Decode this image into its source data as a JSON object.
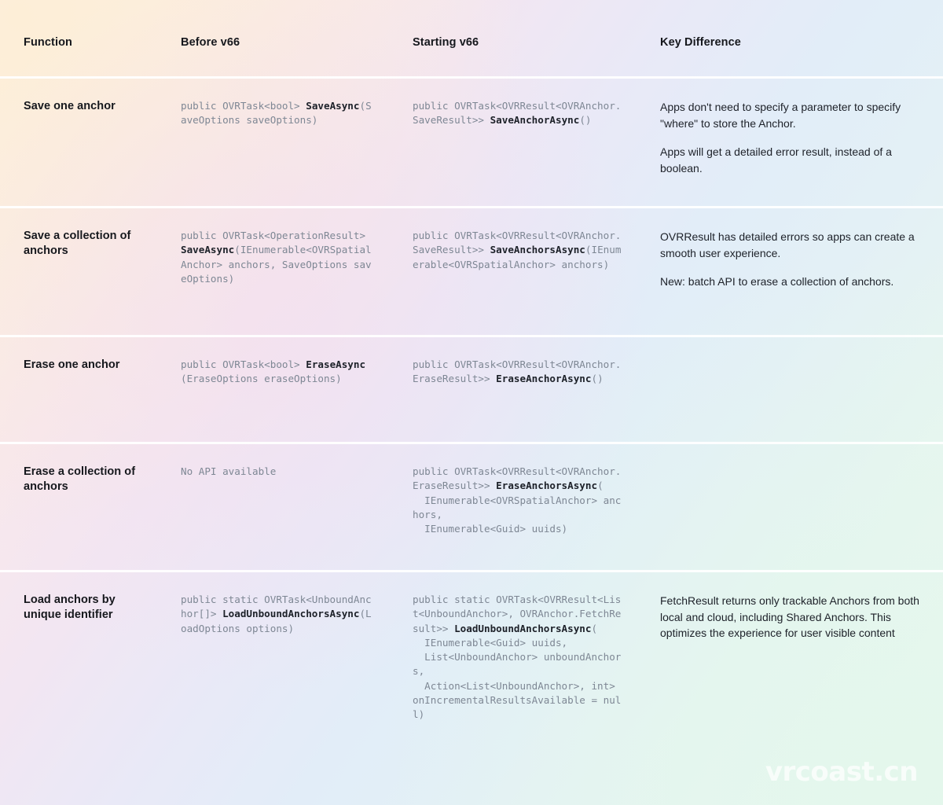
{
  "table": {
    "columns": [
      {
        "id": "function",
        "label": "Function"
      },
      {
        "id": "before",
        "label": "Before v66"
      },
      {
        "id": "starting",
        "label": "Starting v66"
      },
      {
        "id": "key_difference",
        "label": "Key Difference"
      }
    ],
    "rows": [
      {
        "function": "Save one anchor",
        "before_code_plain": "public OVRTask<bool> SaveAsync(SaveOptions saveOptions)",
        "before_code_parts": [
          {
            "text": "public OVRTask<bool> ",
            "bold": false
          },
          {
            "text": "SaveAsync",
            "bold": true
          },
          {
            "text": "(SaveOptions saveOptions)",
            "bold": false
          }
        ],
        "starting_code_plain": "public OVRTask<OVRResult<OVRAnchor.SaveResult>> SaveAnchorAsync()",
        "starting_code_parts": [
          {
            "text": "public OVRTask<OVRResult<OVRAnchor.SaveResult>> ",
            "bold": false
          },
          {
            "text": "SaveAnchorAsync",
            "bold": true
          },
          {
            "text": "()",
            "bold": false
          }
        ],
        "key_difference": [
          "Apps don't need to specify a parameter to specify \"where\" to store the Anchor.",
          "Apps will get a detailed error result, instead of a boolean."
        ]
      },
      {
        "function": "Save a collection of anchors",
        "before_code_plain": "public OVRTask<OperationResult> SaveAsync(IEnumerable<OVRSpatialAnchor> anchors, SaveOptions saveOptions)",
        "before_code_parts": [
          {
            "text": "public OVRTask<OperationResult> ",
            "bold": false
          },
          {
            "text": "SaveAsync",
            "bold": true
          },
          {
            "text": "(IEnumerable<OVRSpatialAnchor> anchors, SaveOptions saveOptions)",
            "bold": false
          }
        ],
        "starting_code_plain": "public OVRTask<OVRResult<OVRAnchor.SaveResult>> SaveAnchorsAsync(IEnumerable<OVRSpatialAnchor> anchors)",
        "starting_code_parts": [
          {
            "text": "public OVRTask<OVRResult<OVRAnchor.SaveResult>> ",
            "bold": false
          },
          {
            "text": "SaveAnchorsAsync",
            "bold": true
          },
          {
            "text": "(IEnumerable<OVRSpatialAnchor> anchors)",
            "bold": false
          }
        ],
        "key_difference": [
          "OVRResult has detailed errors so apps can create a smooth user experience.",
          "New: batch API to erase a collection of anchors."
        ]
      },
      {
        "function": "Erase one anchor",
        "before_code_plain": "public OVRTask<bool> EraseAsync(EraseOptions eraseOptions)",
        "before_code_parts": [
          {
            "text": "public OVRTask<bool> ",
            "bold": false
          },
          {
            "text": "EraseAsync",
            "bold": true
          },
          {
            "text": "(EraseOptions eraseOptions)",
            "bold": false
          }
        ],
        "starting_code_plain": "public OVRTask<OVRResult<OVRAnchor.EraseResult>> EraseAnchorAsync()",
        "starting_code_parts": [
          {
            "text": "public OVRTask<OVRResult<OVRAnchor.EraseResult>> ",
            "bold": false
          },
          {
            "text": "EraseAnchorAsync",
            "bold": true
          },
          {
            "text": "()",
            "bold": false
          }
        ],
        "key_difference": []
      },
      {
        "function": "Erase a collection of anchors",
        "before_code_plain": "No API available",
        "before_code_parts": [
          {
            "text": "No API available",
            "bold": false
          }
        ],
        "starting_code_plain": "public OVRTask<OVRResult<OVRAnchor.EraseResult>> EraseAnchorsAsync(\n  IEnumerable<OVRSpatialAnchor> anchors,\n  IEnumerable<Guid> uuids)",
        "starting_code_parts": [
          {
            "text": "public OVRTask<OVRResult<OVRAnchor.EraseResult>> ",
            "bold": false
          },
          {
            "text": "EraseAnchorsAsync",
            "bold": true
          },
          {
            "text": "(\n  IEnumerable<OVRSpatialAnchor> anchors,\n  IEnumerable<Guid> uuids)",
            "bold": false
          }
        ],
        "key_difference": []
      },
      {
        "function": "Load anchors by unique identifier",
        "before_code_plain": "public static OVRTask<UnboundAnchor[]> LoadUnboundAnchorsAsync(LoadOptions options)",
        "before_code_parts": [
          {
            "text": "public static OVRTask<UnboundAnchor[]> ",
            "bold": false
          },
          {
            "text": "LoadUnboundAnchorsAsync",
            "bold": true
          },
          {
            "text": "(LoadOptions options)",
            "bold": false
          }
        ],
        "starting_code_plain": "public static OVRTask<OVRResult<List<UnboundAnchor>, OVRAnchor.FetchResult>> LoadUnboundAnchorsAsync(\n  IEnumerable<Guid> uuids,\n  List<UnboundAnchor> unboundAnchors,\n  Action<List<UnboundAnchor>, int> onIncrementalResultsAvailable = null)",
        "starting_code_parts": [
          {
            "text": "public static OVRTask<OVRResult<List<UnboundAnchor>, OVRAnchor.FetchResult>> ",
            "bold": false
          },
          {
            "text": "LoadUnboundAnchorsAsync",
            "bold": true
          },
          {
            "text": "(\n  IEnumerable<Guid> uuids,\n  List<UnboundAnchor> unboundAnchors,\n  Action<List<UnboundAnchor>, int> onIncrementalResultsAvailable = null)",
            "bold": false
          }
        ],
        "key_difference": [
          "FetchResult returns only trackable Anchors from both local and cloud, including Shared Anchors. This optimizes the experience for user visible content"
        ]
      }
    ]
  },
  "watermark": {
    "text": "vrcoast.cn"
  },
  "colors": {
    "heading_text": "#16181d",
    "code_muted": "#7e8794",
    "code_emphasis": "#1d2129",
    "note_text": "#1d2129",
    "row_separator": "#ffffff",
    "gradient_top_left": "#fdf3e8",
    "gradient_pink": "#f8e8ec",
    "gradient_lavender": "#e9e9f7",
    "gradient_blue": "#e2edf8",
    "gradient_mint": "#e9f7ef",
    "watermark": "#ffffff"
  }
}
